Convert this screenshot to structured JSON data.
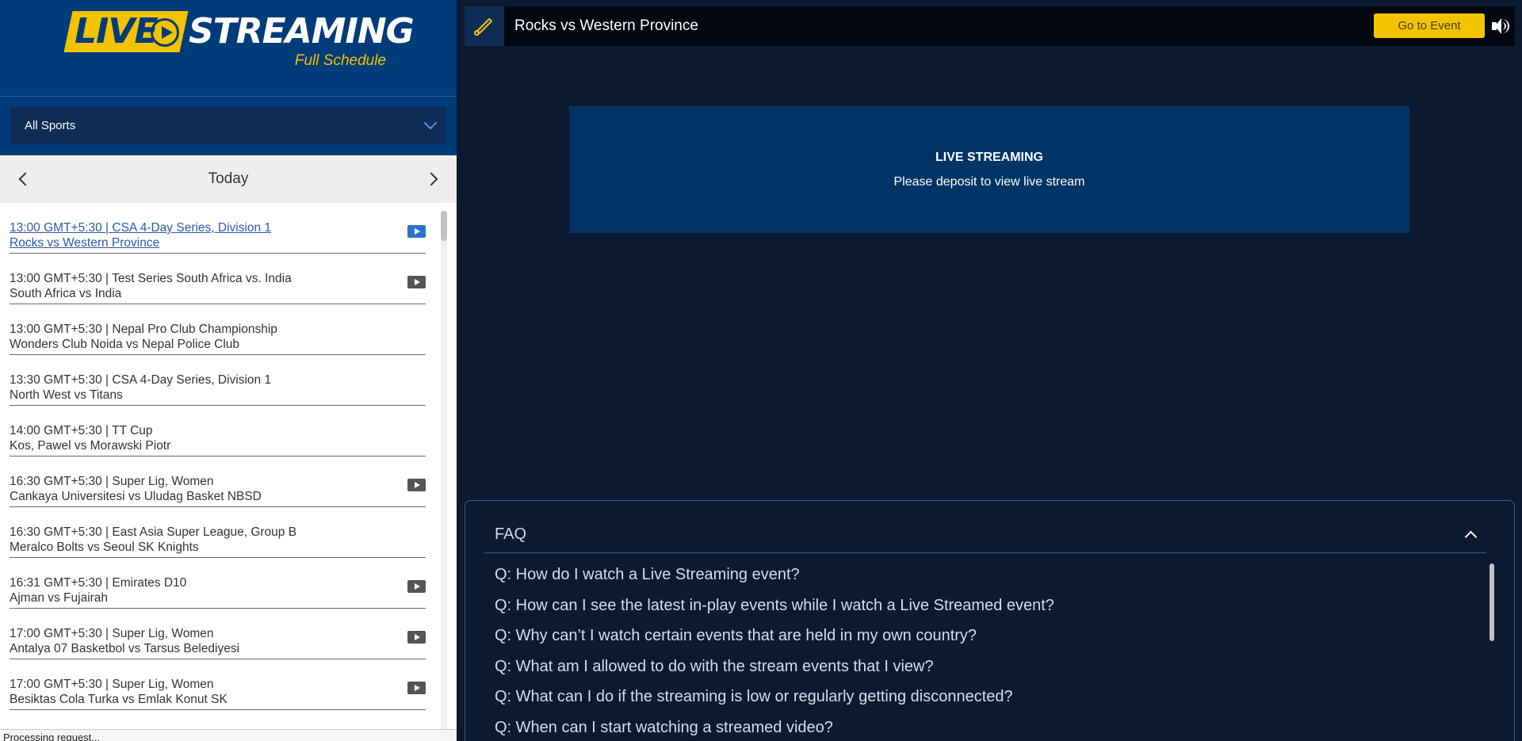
{
  "logo": {
    "live": "LIVE",
    "streaming": "STREAMING",
    "subtitle": "Full Schedule"
  },
  "sport_filter": {
    "selected": "All Sports"
  },
  "date_nav": {
    "label": "Today"
  },
  "events": [
    {
      "line1": "13:00 GMT+5:30 | CSA 4-Day Series, Division 1",
      "line2": "Rocks vs Western Province",
      "stream": "blue",
      "active": true
    },
    {
      "line1": "13:00 GMT+5:30 | Test Series South Africa vs. India",
      "line2": "South Africa vs India",
      "stream": "grey"
    },
    {
      "line1": "13:00 GMT+5:30 | Nepal Pro Club Championship",
      "line2": "Wonders Club Noida vs Nepal Police Club",
      "stream": "none"
    },
    {
      "line1": "13:30 GMT+5:30 | CSA 4-Day Series, Division 1",
      "line2": "North West vs Titans",
      "stream": "none"
    },
    {
      "line1": "14:00 GMT+5:30 | TT Cup",
      "line2": "Kos, Pawel vs Morawski Piotr",
      "stream": "none"
    },
    {
      "line1": "16:30 GMT+5:30 | Super Lig, Women",
      "line2": "Cankaya Universitesi vs Uludag Basket NBSD",
      "stream": "grey"
    },
    {
      "line1": "16:30 GMT+5:30 | East Asia Super League, Group B",
      "line2": "Meralco Bolts vs Seoul SK Knights",
      "stream": "none"
    },
    {
      "line1": "16:31 GMT+5:30 | Emirates D10",
      "line2": "Ajman vs Fujairah",
      "stream": "grey"
    },
    {
      "line1": "17:00 GMT+5:30 | Super Lig, Women",
      "line2": "Antalya 07 Basketbol vs Tarsus Belediyesi",
      "stream": "grey"
    },
    {
      "line1": "17:00 GMT+5:30 | Super Lig, Women",
      "line2": "Besiktas Cola Turka vs Emlak Konut SK",
      "stream": "grey"
    }
  ],
  "status_bar": {
    "text": "Processing request..."
  },
  "header": {
    "event_title": "Rocks vs Western Province",
    "goto_label": "Go to Event"
  },
  "stream": {
    "title": "LIVE STREAMING",
    "message": "Please deposit to view live stream"
  },
  "faq": {
    "title": "FAQ",
    "questions": [
      "Q: How do I watch a Live Streaming event?",
      "Q: How can I see the latest in-play events while I watch a Live Streamed event?",
      "Q: Why can’t I watch certain events that are held in my own country?",
      "Q: What am I allowed to do with the stream events that I view?",
      "Q: What can I do if the streaming is low or regularly getting disconnected?",
      "Q: When can I start watching a streamed video?"
    ]
  },
  "colors": {
    "brand_blue": "#003b7a",
    "accent_yellow": "#f3c300",
    "main_bg": "#0b1a30",
    "stream_box": "#003466"
  }
}
